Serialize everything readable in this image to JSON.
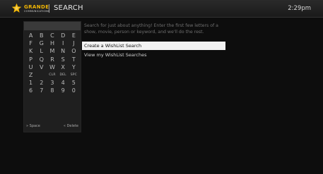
{
  "header": {
    "logo_brand": "GRANDE",
    "logo_sub": "COMMUNICATIONS",
    "title": "SEARCH",
    "time": "2:29pm"
  },
  "colors": {
    "brand_star": "#f2b705",
    "highlight": "#f2f2f2",
    "panel": "#1f1f1f"
  },
  "keyboard": {
    "keys": [
      "A",
      "B",
      "C",
      "D",
      "E",
      "F",
      "G",
      "H",
      "I",
      "J",
      "K",
      "L",
      "M",
      "N",
      "O",
      "P",
      "Q",
      "R",
      "S",
      "T",
      "U",
      "V",
      "W",
      "X",
      "Y",
      "Z",
      "",
      "CLR",
      "DEL",
      "SPC",
      "1",
      "2",
      "3",
      "4",
      "5",
      "6",
      "7",
      "8",
      "9",
      "0"
    ],
    "space_label": "» Space",
    "delete_label": "« Delete"
  },
  "hint": "Search for just about anything! Enter the first few letters of a show, movie, person or keyword, and we'll do the rest.",
  "options": [
    {
      "label": "Create a WishList Search",
      "selected": true
    },
    {
      "label": "View my WishList Searches",
      "selected": false
    }
  ]
}
